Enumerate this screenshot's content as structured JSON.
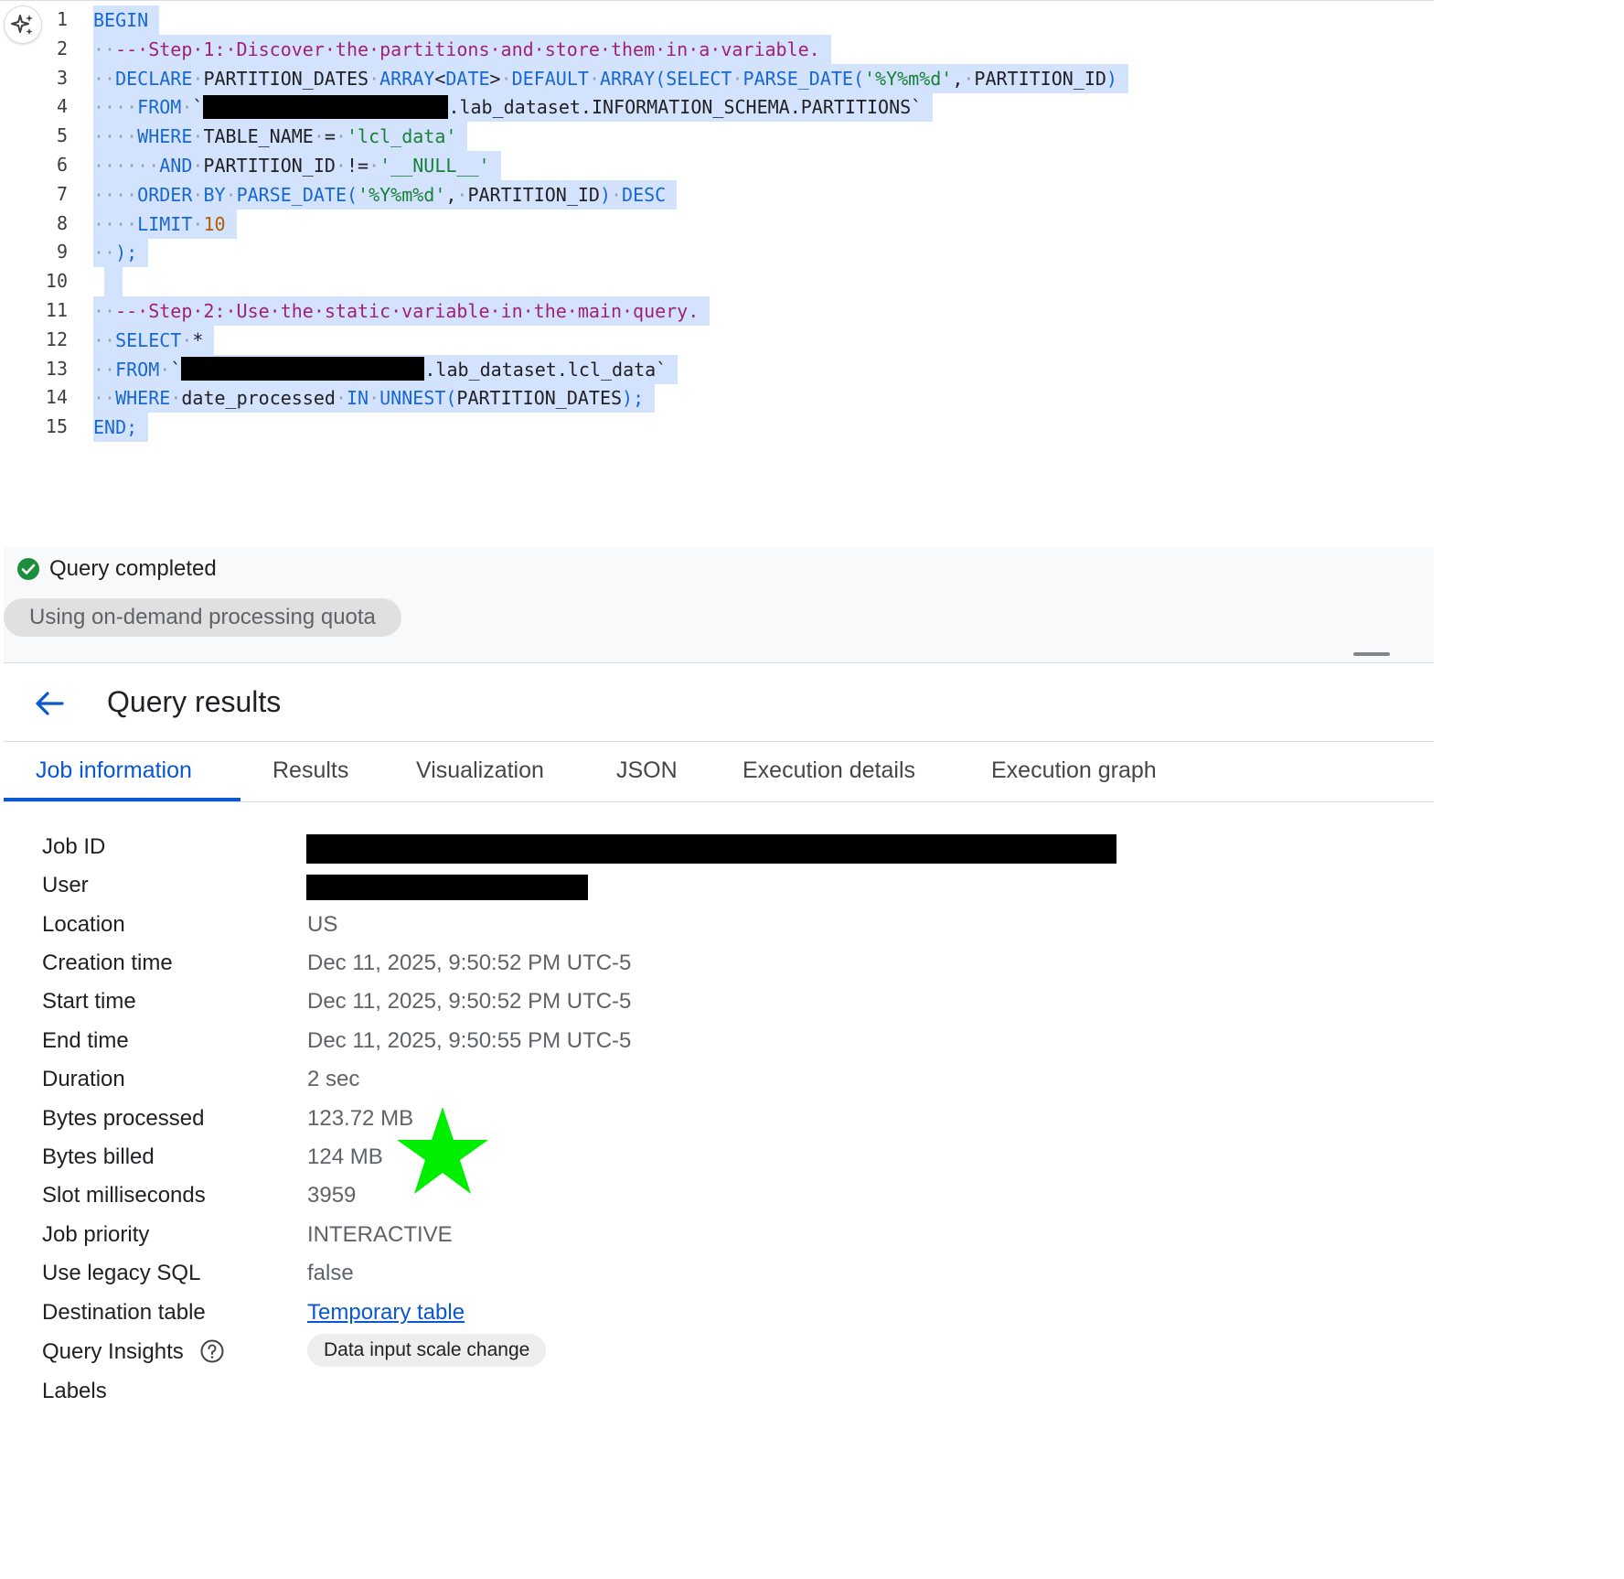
{
  "editor": {
    "lines": [
      {
        "n": "1",
        "segments": [
          {
            "c": "kw",
            "t": "BEGIN"
          }
        ]
      },
      {
        "n": "2",
        "segments": [
          {
            "c": "dot",
            "t": "··"
          },
          {
            "c": "cm",
            "t": "--·Step·1:·Discover·the·partitions·and·store·them·in·a·variable."
          }
        ]
      },
      {
        "n": "3",
        "segments": [
          {
            "c": "dot",
            "t": "··"
          },
          {
            "c": "kw",
            "t": "DECLARE"
          },
          {
            "c": "dot",
            "t": "·"
          },
          {
            "c": "pl",
            "t": "PARTITION_DATES"
          },
          {
            "c": "dot",
            "t": "·"
          },
          {
            "c": "kw",
            "t": "ARRAY"
          },
          {
            "c": "pl",
            "t": "<"
          },
          {
            "c": "kw",
            "t": "DATE"
          },
          {
            "c": "pl",
            "t": ">"
          },
          {
            "c": "dot",
            "t": "·"
          },
          {
            "c": "kw",
            "t": "DEFAULT"
          },
          {
            "c": "dot",
            "t": "·"
          },
          {
            "c": "kw",
            "t": "ARRAY(SELECT"
          },
          {
            "c": "dot",
            "t": "·"
          },
          {
            "c": "kw",
            "t": "PARSE_DATE("
          },
          {
            "c": "st",
            "t": "'%Y%m%d'"
          },
          {
            "c": "pl",
            "t": ","
          },
          {
            "c": "dot",
            "t": "·"
          },
          {
            "c": "pl",
            "t": "PARTITION_ID"
          },
          {
            "c": "kw",
            "t": ")"
          }
        ]
      },
      {
        "n": "4",
        "segments": [
          {
            "c": "dot",
            "t": "····"
          },
          {
            "c": "kw",
            "t": "FROM"
          },
          {
            "c": "dot",
            "t": "·"
          },
          {
            "c": "pl",
            "t": "`"
          },
          {
            "c": "redact",
            "w": 268
          },
          {
            "c": "pl",
            "t": ".lab_dataset.INFORMATION_SCHEMA.PARTITIONS`"
          }
        ]
      },
      {
        "n": "5",
        "segments": [
          {
            "c": "dot",
            "t": "····"
          },
          {
            "c": "kw",
            "t": "WHERE"
          },
          {
            "c": "dot",
            "t": "·"
          },
          {
            "c": "pl",
            "t": "TABLE_NAME"
          },
          {
            "c": "dot",
            "t": "·"
          },
          {
            "c": "pl",
            "t": "="
          },
          {
            "c": "dot",
            "t": "·"
          },
          {
            "c": "st",
            "t": "'lcl_data'"
          }
        ]
      },
      {
        "n": "6",
        "segments": [
          {
            "c": "dot",
            "t": "······"
          },
          {
            "c": "kw",
            "t": "AND"
          },
          {
            "c": "dot",
            "t": "·"
          },
          {
            "c": "pl",
            "t": "PARTITION_ID"
          },
          {
            "c": "dot",
            "t": "·"
          },
          {
            "c": "pl",
            "t": "!="
          },
          {
            "c": "dot",
            "t": "·"
          },
          {
            "c": "st",
            "t": "'__NULL__'"
          }
        ]
      },
      {
        "n": "7",
        "segments": [
          {
            "c": "dot",
            "t": "····"
          },
          {
            "c": "kw",
            "t": "ORDER"
          },
          {
            "c": "dot",
            "t": "·"
          },
          {
            "c": "kw",
            "t": "BY"
          },
          {
            "c": "dot",
            "t": "·"
          },
          {
            "c": "kw",
            "t": "PARSE_DATE("
          },
          {
            "c": "st",
            "t": "'%Y%m%d'"
          },
          {
            "c": "pl",
            "t": ","
          },
          {
            "c": "dot",
            "t": "·"
          },
          {
            "c": "pl",
            "t": "PARTITION_ID"
          },
          {
            "c": "kw",
            "t": ")"
          },
          {
            "c": "dot",
            "t": "·"
          },
          {
            "c": "kw",
            "t": "DESC"
          }
        ]
      },
      {
        "n": "8",
        "segments": [
          {
            "c": "dot",
            "t": "····"
          },
          {
            "c": "kw",
            "t": "LIMIT"
          },
          {
            "c": "dot",
            "t": "·"
          },
          {
            "c": "nm",
            "t": "10"
          }
        ]
      },
      {
        "n": "9",
        "segments": [
          {
            "c": "dot",
            "t": "··"
          },
          {
            "c": "kw",
            "t": ");"
          }
        ]
      },
      {
        "n": "10",
        "segments": [
          {
            "c": "pl",
            "t": " "
          }
        ]
      },
      {
        "n": "11",
        "segments": [
          {
            "c": "dot",
            "t": "··"
          },
          {
            "c": "cm",
            "t": "--·Step·2:·Use·the·static·variable·in·the·main·query."
          }
        ]
      },
      {
        "n": "12",
        "segments": [
          {
            "c": "dot",
            "t": "··"
          },
          {
            "c": "kw",
            "t": "SELECT"
          },
          {
            "c": "dot",
            "t": "·"
          },
          {
            "c": "pl",
            "t": "*"
          }
        ]
      },
      {
        "n": "13",
        "segments": [
          {
            "c": "dot",
            "t": "··"
          },
          {
            "c": "kw",
            "t": "FROM"
          },
          {
            "c": "dot",
            "t": "·"
          },
          {
            "c": "pl",
            "t": "`"
          },
          {
            "c": "redact",
            "w": 266
          },
          {
            "c": "pl",
            "t": ".lab_dataset.lcl_data`"
          }
        ]
      },
      {
        "n": "14",
        "segments": [
          {
            "c": "dot",
            "t": "··"
          },
          {
            "c": "kw",
            "t": "WHERE"
          },
          {
            "c": "dot",
            "t": "·"
          },
          {
            "c": "pl",
            "t": "date_processed"
          },
          {
            "c": "dot",
            "t": "·"
          },
          {
            "c": "kw",
            "t": "IN"
          },
          {
            "c": "dot",
            "t": "·"
          },
          {
            "c": "kw",
            "t": "UNNEST("
          },
          {
            "c": "pl",
            "t": "PARTITION_DATES"
          },
          {
            "c": "kw",
            "t": ");"
          }
        ]
      },
      {
        "n": "15",
        "segments": [
          {
            "c": "kw",
            "t": "END;"
          }
        ]
      }
    ]
  },
  "status": {
    "text": "Query completed",
    "quota": "Using on-demand processing quota"
  },
  "results": {
    "title": "Query results",
    "tabs": [
      "Job information",
      "Results",
      "Visualization",
      "JSON",
      "Execution details",
      "Execution graph"
    ]
  },
  "job_info": {
    "job_id_label": "Job ID",
    "user_label": "User",
    "location_label": "Location",
    "location": "US",
    "creation_label": "Creation time",
    "creation": "Dec 11, 2025, 9:50:52 PM UTC-5",
    "start_label": "Start time",
    "start": "Dec 11, 2025, 9:50:52 PM UTC-5",
    "end_label": "End time",
    "end": "Dec 11, 2025, 9:50:55 PM UTC-5",
    "duration_label": "Duration",
    "duration": "2 sec",
    "bytes_processed_label": "Bytes processed",
    "bytes_processed": "123.72 MB",
    "bytes_billed_label": "Bytes billed",
    "bytes_billed": "124 MB",
    "slot_ms_label": "Slot milliseconds",
    "slot_ms": "3959",
    "priority_label": "Job priority",
    "priority": "INTERACTIVE",
    "legacy_label": "Use legacy SQL",
    "legacy": "false",
    "dest_label": "Destination table",
    "dest": "Temporary table",
    "insights_label": "Query Insights",
    "insight_chip": "Data input scale change",
    "labels_label": "Labels"
  },
  "colors": {
    "keyword": "#1967d2",
    "comment": "#a0207a",
    "string": "#188038",
    "number": "#b06000",
    "selection": "#d3e3fd",
    "accent": "#0b57d0",
    "success": "#1e8e3e",
    "star": "#00ee00"
  },
  "icons": {
    "ai": "sparkle-icon",
    "status": "check-circle-icon",
    "back": "arrow-back-icon",
    "help": "help-circle-icon",
    "annotation": "star-icon"
  }
}
